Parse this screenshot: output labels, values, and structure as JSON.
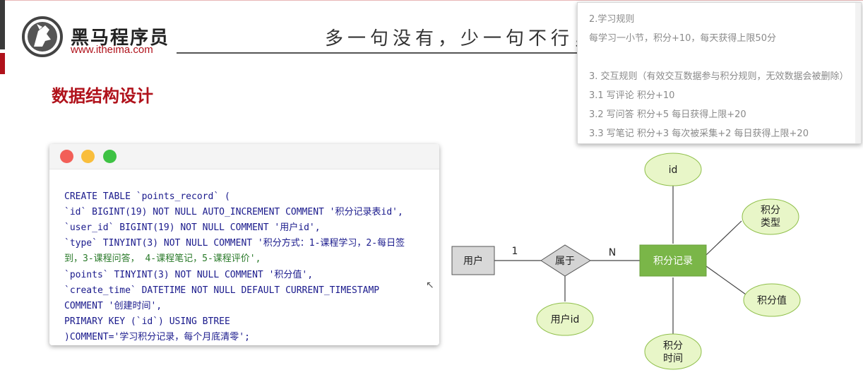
{
  "brand": {
    "name": "黑马程序员",
    "url": "www.itheima.com"
  },
  "slogan": "多一句没有，少一句不行，用",
  "section_title": "数据结构设计",
  "code": {
    "lines": [
      "CREATE TABLE `points_record` (",
      "`id` BIGINT(19) NOT NULL AUTO_INCREMENT COMMENT '积分记录表id',",
      "`user_id` BIGINT(19) NOT NULL COMMENT '用户id',",
      "`type` TINYINT(3) NOT NULL COMMENT '积分方式：1-课程学习，2-每日签",
      "到，3-课程问答， 4-课程笔记，5-课程评价',",
      "`points` TINYINT(3) NOT NULL COMMENT '积分值',",
      "`create_time` DATETIME NOT NULL DEFAULT CURRENT_TIMESTAMP",
      "COMMENT '创建时间',",
      "PRIMARY KEY (`id`) USING BTREE",
      ")COMMENT='学习积分记录，每个月底清零';"
    ]
  },
  "popup": {
    "lines": [
      "2.学习规则",
      "每学习一小节，积分+10，每天获得上限50分",
      "3. 交互规则（有效交互数据参与积分规则，无效数据会被删除）",
      "3.1 写评论 积分+10",
      "3.2 写问答 积分+5 每日获得上限+20",
      "3.3 写笔记 积分+3 每次被采集+2 每日获得上限+20"
    ]
  },
  "er": {
    "user_entity": "用户",
    "relation": "属于",
    "points_entity": "积分记录",
    "card_left": "1",
    "card_right": "N",
    "attr_user_id": "用户id",
    "attr_id": "id",
    "attr_type_1": "积分",
    "attr_type_2": "类型",
    "attr_value": "积分值",
    "attr_time_1": "积分",
    "attr_time_2": "时间"
  },
  "colors": {
    "brand_red": "#b0121b",
    "entity_green": "#7ab648",
    "attr_fill": "#e8f6c8",
    "attr_stroke": "#8fbf4a"
  }
}
